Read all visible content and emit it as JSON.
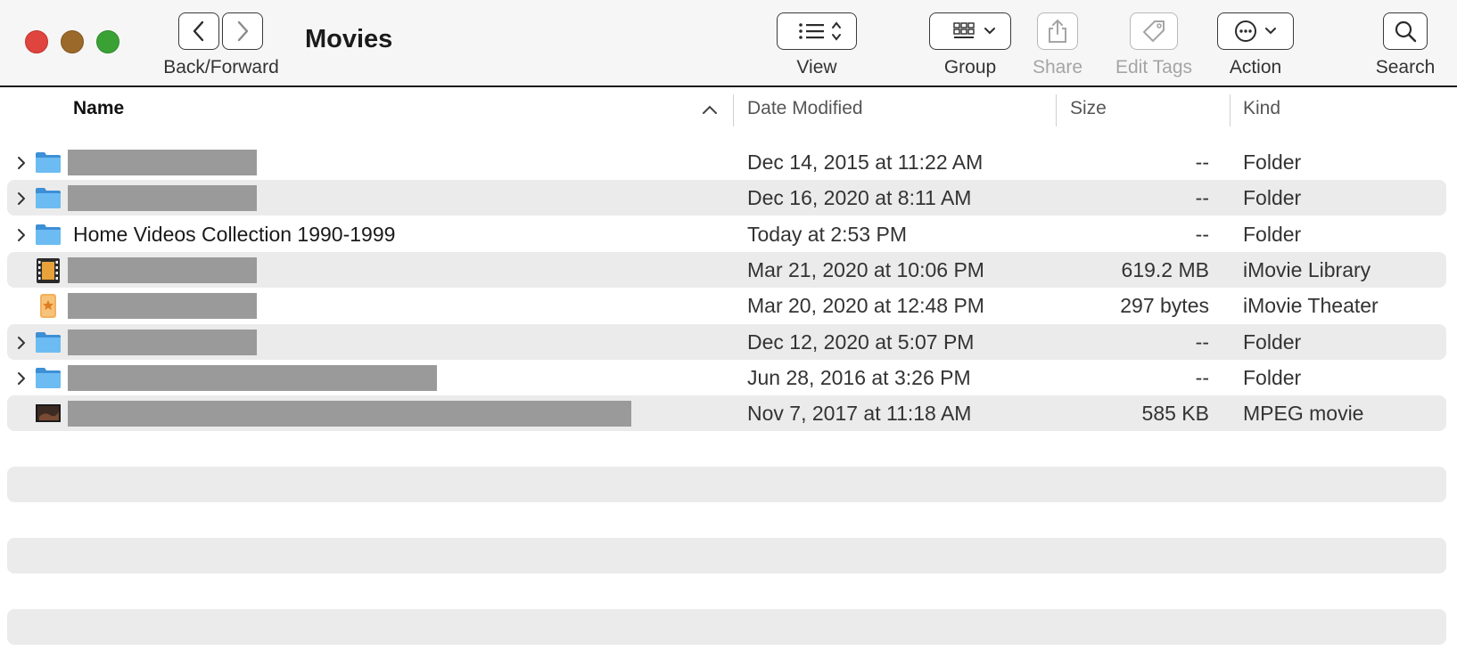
{
  "toolbar": {
    "title": "Movies",
    "back_forward_label": "Back/Forward",
    "view_label": "View",
    "group_label": "Group",
    "share_label": "Share",
    "edit_tags_label": "Edit Tags",
    "action_label": "Action",
    "search_label": "Search"
  },
  "columns": {
    "name": "Name",
    "date": "Date Modified",
    "size": "Size",
    "kind": "Kind"
  },
  "files": [
    {
      "name": "",
      "redacted": true,
      "icon": "folder-icon",
      "date": "Dec 14, 2015 at 11:22 AM",
      "size": "--",
      "kind": "Folder"
    },
    {
      "name": "",
      "redacted": true,
      "icon": "folder-icon",
      "date": "Dec 16, 2020 at 8:11 AM",
      "size": "--",
      "kind": "Folder"
    },
    {
      "name": "Home Videos Collection 1990-1999",
      "redacted": false,
      "icon": "folder-icon",
      "date": "Today at 2:53 PM",
      "size": "--",
      "kind": "Folder"
    },
    {
      "name": "",
      "redacted": true,
      "icon": "imovie-library-icon",
      "date": "Mar 21, 2020 at 10:06 PM",
      "size": "619.2 MB",
      "kind": "iMovie Library"
    },
    {
      "name": "",
      "redacted": true,
      "icon": "imovie-theater-icon",
      "date": "Mar 20, 2020 at 12:48 PM",
      "size": "297 bytes",
      "kind": "iMovie Theater"
    },
    {
      "name": "",
      "redacted": true,
      "icon": "folder-icon",
      "date": "Dec 12, 2020 at 5:07 PM",
      "size": "--",
      "kind": "Folder"
    },
    {
      "name": "",
      "redacted": true,
      "icon": "folder-icon",
      "date": "Jun 28, 2016 at 3:26 PM",
      "size": "--",
      "kind": "Folder"
    },
    {
      "name": "",
      "redacted": true,
      "icon": "movie-file-icon",
      "date": "Nov 7, 2017 at 11:18 AM",
      "size": "585 KB",
      "kind": "MPEG movie"
    }
  ],
  "colors": {
    "close": "#e0443e",
    "minimize": "#9b6a2b",
    "zoom": "#3aa235",
    "folder": "#5aaeea",
    "stripe": "#ebebeb"
  }
}
